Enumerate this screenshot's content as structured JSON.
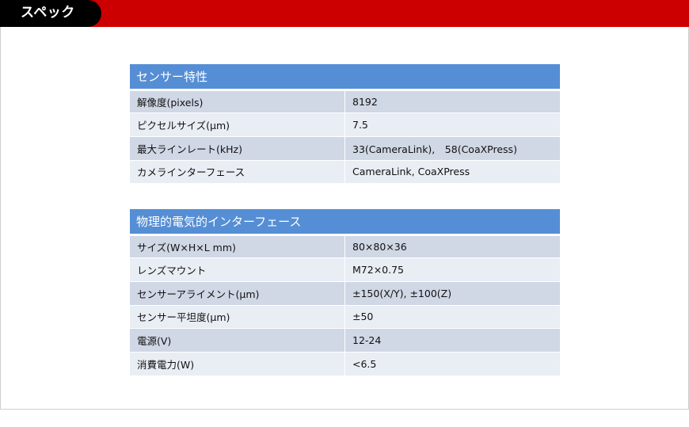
{
  "header": {
    "title": "スペック"
  },
  "sensor": {
    "title": "センサー特性",
    "rows": [
      {
        "label": "解像度(pixels)",
        "value": "8192"
      },
      {
        "label": "ピクセルサイズ(μm)",
        "value": "7.5"
      },
      {
        "label": "最大ラインレート(kHz)",
        "value": "33(CameraLink),　58(CoaXPress)"
      },
      {
        "label": "カメラインターフェース",
        "value": "CameraLink, CoaXPress"
      }
    ]
  },
  "physical": {
    "title": "物理的電気的インターフェース",
    "rows": [
      {
        "label": "サイズ(W×H×L mm)",
        "value": "80×80×36"
      },
      {
        "label": "レンズマウント",
        "value": "M72×0.75"
      },
      {
        "label": "センサーアライメント(μm)",
        "value": "±150(X/Y), ±100(Z)"
      },
      {
        "label": "センサー平坦度(μm)",
        "value": "±50"
      },
      {
        "label": "電源(V)",
        "value": "12-24"
      },
      {
        "label": "消費電力(W)",
        "value": "<6.5"
      }
    ]
  }
}
